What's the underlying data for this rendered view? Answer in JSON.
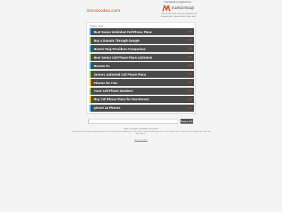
{
  "header": {
    "domain": "boostcodes.com",
    "sale_note": "This domain is registered at",
    "logo_text": "namecheap",
    "logo_caption": "This domain was recently registered at Namecheap. Please check back later!"
  },
  "panel": {
    "title": "Related Links",
    "links": [
      {
        "label": "Best Senior Unlimited Cell Phone Plans",
        "accent": "#2eaadc"
      },
      {
        "label": "Buy a Domain Through Google",
        "accent": "#8bc34a"
      },
      {
        "label": "Hosted Voip Providers Comparison",
        "accent": "#2eaadc"
      },
      {
        "label": "Best Senior Cell Phone Plans Unlimited",
        "accent": "#8bc34a"
      },
      {
        "label": "Remote Pc",
        "accent": "#2eaadc"
      },
      {
        "label": "Seniors Unlimited Cell Phone Plans",
        "accent": "#8bc34a"
      },
      {
        "label": "Phones for Free",
        "accent": "#f2b705"
      },
      {
        "label": "Trace Cell Phone Numbers",
        "accent": "#8bc34a"
      },
      {
        "label": "Buy Cell Phone Plans for One Person",
        "accent": "#f2b705"
      },
      {
        "label": "Iphone 12 Phones",
        "accent": "#2eaadc"
      }
    ],
    "arrow_glyph": ">>"
  },
  "search": {
    "placeholder": "",
    "button_label": "Search Ads"
  },
  "footer": {
    "copyright": "2024 Copyright. All Rights Reserved.",
    "disclaimer": "The Sponsored Listings displayed above are served automatically by a third party. Neither Parkingcrew nor the domain owner maintain any relationship with the advertisers.",
    "privacy": "Privacy Policy"
  },
  "colors": {
    "accent": "#e8542c",
    "row_bg": "#4a4a4a",
    "page_bg": "#f4f4f4"
  }
}
